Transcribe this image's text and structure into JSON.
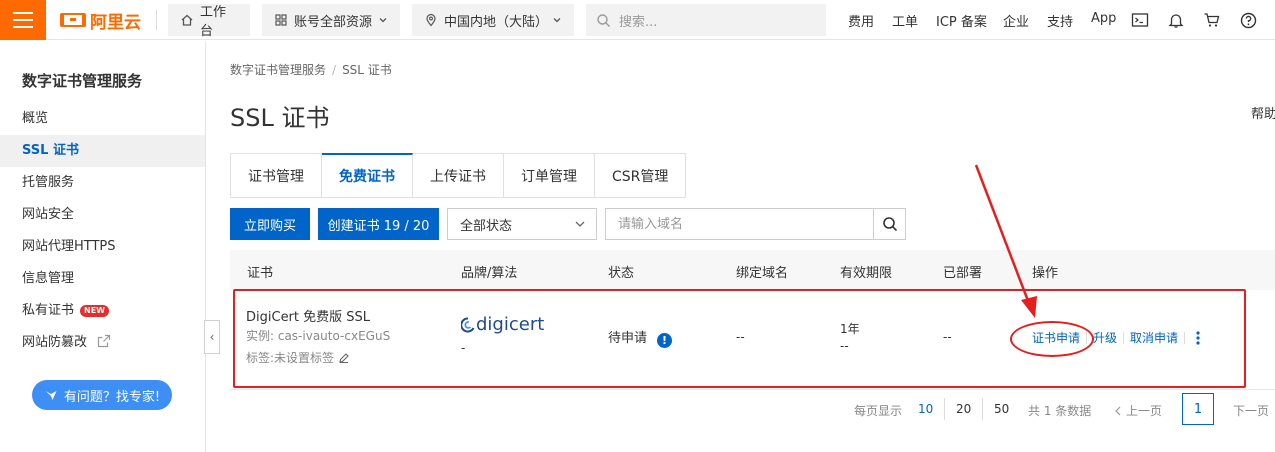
{
  "topbar": {
    "logo_text": "阿里云",
    "workbench": "工作台",
    "account_scope": "账号全部资源",
    "region": "中国内地（大陆）",
    "search_placeholder": "搜索...",
    "links": [
      "费用",
      "工单",
      "ICP 备案",
      "企业",
      "支持",
      "App"
    ],
    "accent_color": "#ff6a00"
  },
  "sidebar": {
    "title": "数字证书管理服务",
    "items": [
      {
        "label": "概览"
      },
      {
        "label": "SSL 证书",
        "active": true
      },
      {
        "label": "托管服务"
      },
      {
        "label": "网站安全"
      },
      {
        "label": "网站代理HTTPS"
      },
      {
        "label": "信息管理"
      },
      {
        "label": "私有证书",
        "badge": "NEW"
      },
      {
        "label": "网站防篡改",
        "icon": "external-link-icon"
      }
    ],
    "expert_button": "有问题？找专家!"
  },
  "breadcrumb": [
    "数字证书管理服务",
    "SSL 证书"
  ],
  "page": {
    "title": "SSL 证书",
    "help": "帮助"
  },
  "tabs": [
    {
      "label": "证书管理"
    },
    {
      "label": "免费证书",
      "active": true
    },
    {
      "label": "上传证书"
    },
    {
      "label": "订单管理"
    },
    {
      "label": "CSR管理"
    }
  ],
  "toolbar": {
    "buy_now": "立即购买",
    "create_cert": "创建证书 19 / 20",
    "status_select": "全部状态",
    "domain_placeholder": "请输入域名"
  },
  "table": {
    "headers": [
      "证书",
      "品牌/算法",
      "状态",
      "绑定域名",
      "有效期限",
      "已部署",
      "操作"
    ],
    "rows": [
      {
        "name": "DigiCert 免费版 SSL",
        "instance": "实例: cas-ivauto-cxEGuS",
        "tags": "标签:未设置标签",
        "brand": "digicert",
        "brand_sub": "-",
        "status": "待申请",
        "domain": "--",
        "validity": "1年",
        "validity_sub": "--",
        "deployed": "--",
        "actions": [
          "证书申请",
          "升级",
          "取消申请"
        ]
      }
    ]
  },
  "pagination": {
    "page_size_label": "每页显示",
    "sizes": [
      "10",
      "20",
      "50"
    ],
    "active_size": "10",
    "total": "共 1 条数据",
    "prev": "上一页",
    "current": "1",
    "next": "下一页"
  },
  "colors": {
    "primary": "#0064c8",
    "annotation": "#e31f1f"
  }
}
